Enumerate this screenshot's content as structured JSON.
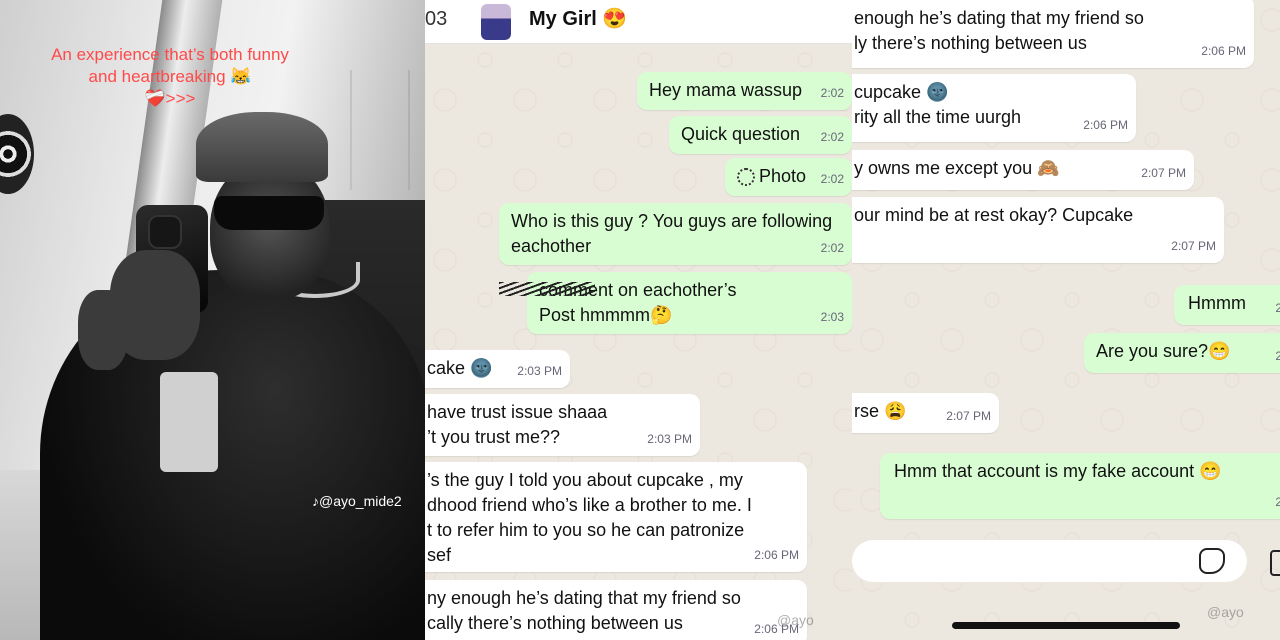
{
  "photo": {
    "caption": "An experience that’s both funny and heartbreaking 😹\n❤️‍🩹>>>",
    "tiktok_handle": "@ayo_mide2"
  },
  "chat_header": {
    "back_count": "03",
    "contact_name": "My Girl",
    "contact_emoji": "😍"
  },
  "middle_messages": [
    {
      "text": "Hey mama wassup",
      "time": "2:02",
      "dir": "out"
    },
    {
      "text": "Quick question",
      "time": "2:02",
      "dir": "out"
    },
    {
      "text": "Photo",
      "time": "2:02",
      "dir": "out"
    },
    {
      "text": "Who is  this guy ? You guys are following\neachother",
      "time": "2:02",
      "dir": "out"
    },
    {
      "text": "comment on eachother’s\nPost hmmmm🤔",
      "time": "2:03",
      "dir": "out"
    },
    {
      "text": "cake 🌚",
      "time": "2:03 PM",
      "dir": "in"
    },
    {
      "text": "have trust  issue shaaa\n’t you trust me??",
      "time": "2:03 PM",
      "dir": "in"
    },
    {
      "text": "’s the guy I told you about cupcake , my\ndhood friend who’s like a brother to me. I\nt to refer him to you so he can patronize\nsef",
      "time": "2:06 PM",
      "dir": "in"
    },
    {
      "text": "ny enough he’s dating that my friend so\ncally there’s nothing between us",
      "time": "2:06 PM",
      "dir": "in"
    }
  ],
  "right_messages": [
    {
      "text": "enough he’s dating that my friend so\nly there’s nothing between us",
      "time": "2:06 PM",
      "dir": "in"
    },
    {
      "text": "cupcake 🌚\nrity all the time uurgh",
      "time": "2:06 PM",
      "dir": "in"
    },
    {
      "text": "y owns me except you 🙈",
      "time": "2:07 PM",
      "dir": "in"
    },
    {
      "text": "our mind be at rest okay? Cupcake",
      "time": "2:07 PM",
      "dir": "in"
    },
    {
      "text": "Hmmm",
      "time": "2",
      "dir": "out"
    },
    {
      "text": "Are you sure?😁",
      "time": "2",
      "dir": "out"
    },
    {
      "text": "rse 😩",
      "time": "2:07 PM",
      "dir": "in"
    },
    {
      "text": "Hmm that account is my fake account 😁",
      "time": "2",
      "dir": "out"
    }
  ],
  "watermarks": {
    "mid": "@ayo",
    "right": "@ayo"
  },
  "colors": {
    "chat_bg": "#ece7df",
    "outgoing_bubble": "#d9fdd3",
    "incoming_bubble": "#ffffff",
    "caption_red": "#ff4a4a"
  }
}
